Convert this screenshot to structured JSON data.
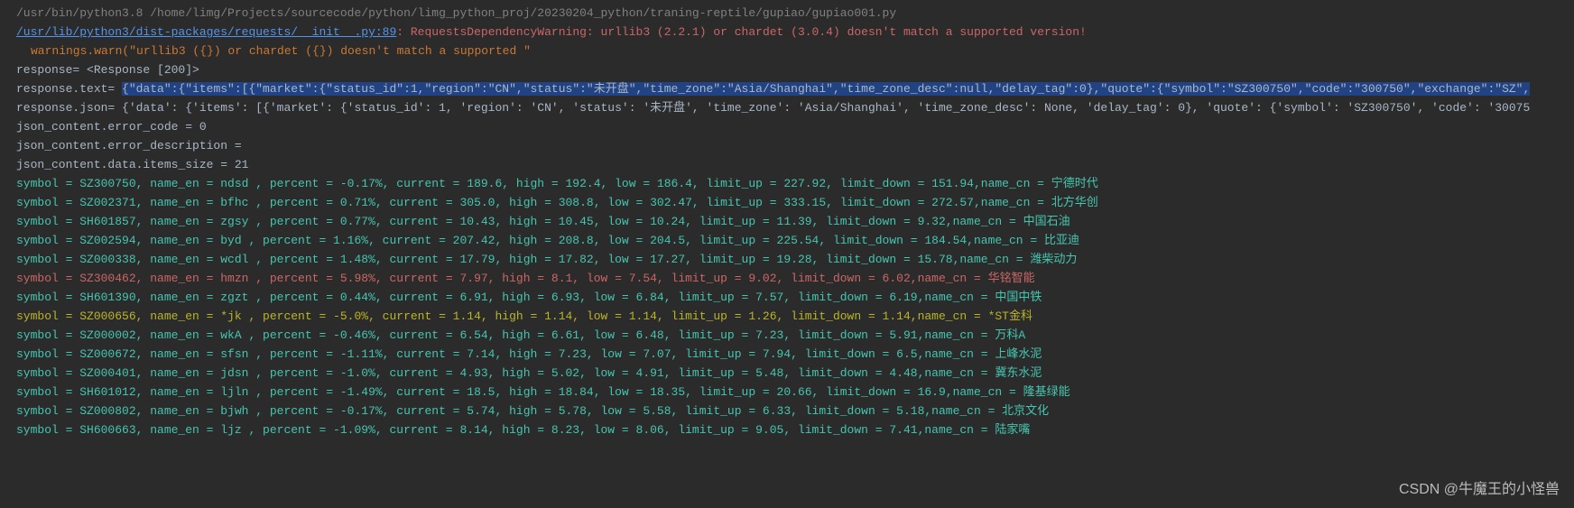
{
  "header": {
    "script_path": "/usr/bin/python3.8 /home/limg/Projects/sourcecode/python/limg_python_proj/20230204_python/traning-reptile/gupiao/gupiao001.py",
    "link_path": "/usr/lib/python3/dist-packages/requests/__init__.py:89",
    "warning_label": ": RequestsDependencyWarning: urllib3 (2.2.1) or chardet (3.0.4) doesn't match a supported version!",
    "warnings_warn": "warnings.warn(\"urllib3 ({}) or chardet ({}) doesn't match a supported \"",
    "response_line": "response= <Response [200]>",
    "response_text_prefix": "response.text= ",
    "response_text_body": "{\"data\":{\"items\":[{\"market\":{\"status_id\":1,\"region\":\"CN\",\"status\":\"未开盘\",\"time_zone\":\"Asia/Shanghai\",\"time_zone_desc\":null,\"delay_tag\":0},\"quote\":{\"symbol\":\"SZ300750\",\"code\":\"300750\",\"exchange\":\"SZ\",",
    "response_json": "response.json= {'data': {'items': [{'market': {'status_id': 1, 'region': 'CN', 'status': '未开盘', 'time_zone': 'Asia/Shanghai', 'time_zone_desc': None, 'delay_tag': 0}, 'quote': {'symbol': 'SZ300750', 'code': '30075",
    "error_code": "json_content.error_code       = 0",
    "error_desc": "json_content.error_description =",
    "items_size": "json_content.data.items_size   = 21"
  },
  "rows": [
    {
      "style": "teal",
      "text": "symbol = SZ300750, name_en = ndsd  , percent = -0.17%, current = 189.6, high = 192.4, low = 186.4, limit_up = 227.92, limit_down = 151.94,name_cn = 宁德时代"
    },
    {
      "style": "teal",
      "text": "symbol = SZ002371, name_en = bfhc  , percent = 0.71%, current = 305.0, high = 308.8, low = 302.47, limit_up = 333.15, limit_down = 272.57,name_cn = 北方华创"
    },
    {
      "style": "teal",
      "text": "symbol = SH601857, name_en = zgsy  , percent = 0.77%, current = 10.43, high = 10.45, low = 10.24, limit_up = 11.39, limit_down = 9.32,name_cn = 中国石油"
    },
    {
      "style": "teal",
      "text": "symbol = SZ002594, name_en = byd   , percent = 1.16%, current = 207.42, high = 208.8, low = 204.5, limit_up = 225.54, limit_down = 184.54,name_cn = 比亚迪"
    },
    {
      "style": "teal",
      "text": "symbol = SZ000338, name_en = wcdl  , percent = 1.48%, current = 17.79, high = 17.82, low = 17.27, limit_up = 19.28, limit_down = 15.78,name_cn = 潍柴动力"
    },
    {
      "style": "teal-red",
      "text": "symbol = SZ300462, name_en = hmzn  , percent = 5.98%, current = 7.97, high = 8.1, low = 7.54, limit_up = 9.02, limit_down = 6.02,name_cn = 华铭智能"
    },
    {
      "style": "teal",
      "text": "symbol = SH601390, name_en = zgzt  , percent = 0.44%, current = 6.91, high = 6.93, low = 6.84, limit_up = 7.57, limit_down = 6.19,name_cn = 中国中铁"
    },
    {
      "style": "teal-yellow",
      "text": "symbol = SZ000656, name_en = *jk   , percent = -5.0%, current = 1.14, high = 1.14, low = 1.14, limit_up = 1.26, limit_down = 1.14,name_cn = *ST金科"
    },
    {
      "style": "teal",
      "text": "symbol = SZ000002, name_en = wkA   , percent = -0.46%, current = 6.54, high = 6.61, low = 6.48, limit_up = 7.23, limit_down = 5.91,name_cn = 万科A"
    },
    {
      "style": "teal",
      "text": "symbol = SZ000672, name_en = sfsn  , percent = -1.11%, current = 7.14, high = 7.23, low = 7.07, limit_up = 7.94, limit_down = 6.5,name_cn = 上峰水泥"
    },
    {
      "style": "teal",
      "text": "symbol = SZ000401, name_en = jdsn  , percent = -1.0%, current = 4.93, high = 5.02, low = 4.91, limit_up = 5.48, limit_down = 4.48,name_cn = 冀东水泥"
    },
    {
      "style": "teal",
      "text": "symbol = SH601012, name_en = ljln  , percent = -1.49%, current = 18.5, high = 18.84, low = 18.35, limit_up = 20.66, limit_down = 16.9,name_cn = 隆基绿能"
    },
    {
      "style": "teal",
      "text": "symbol = SZ000802, name_en = bjwh  , percent = -0.17%, current = 5.74, high = 5.78, low = 5.58, limit_up = 6.33, limit_down = 5.18,name_cn = 北京文化"
    },
    {
      "style": "teal",
      "text": "symbol = SH600663, name_en = ljz   , percent = -1.09%, current = 8.14, high = 8.23, low = 8.06, limit_up = 9.05, limit_down = 7.41,name_cn = 陆家嘴"
    }
  ],
  "watermark": "CSDN @牛魔王的小怪兽"
}
